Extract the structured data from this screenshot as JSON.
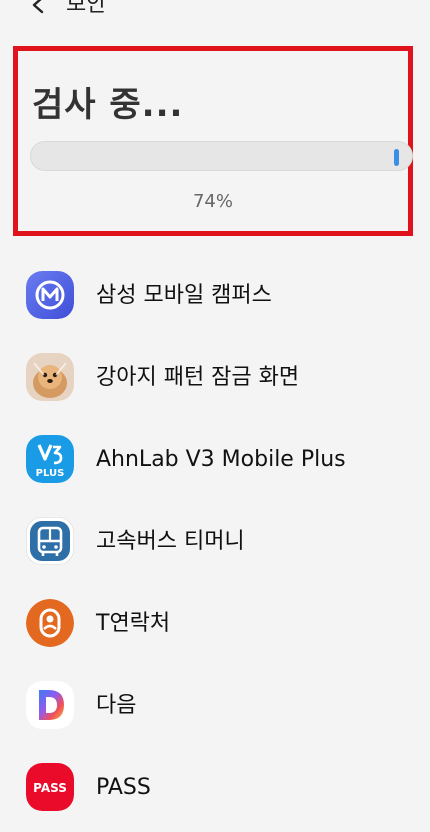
{
  "header": {
    "back_icon": "chevron-left-icon",
    "title": "보안"
  },
  "scan": {
    "title": "검사 중...",
    "progress_percent": 74,
    "progress_label": "74%",
    "highlight_color": "#e0121b",
    "marker_color": "#3a8ee6"
  },
  "apps": [
    {
      "label": "삼성 모바일 캠퍼스",
      "icon": "samsung-campus-icon"
    },
    {
      "label": "강아지 패턴 잠금 화면",
      "icon": "puppy-lockscreen-icon"
    },
    {
      "label": "AhnLab V3 Mobile Plus",
      "icon": "v3-icon",
      "icon_text": "PLUS"
    },
    {
      "label": "고속버스 티머니",
      "icon": "bus-icon"
    },
    {
      "label": "T연락처",
      "icon": "t-contacts-icon"
    },
    {
      "label": "다음",
      "icon": "daum-icon"
    },
    {
      "label": "PASS",
      "icon": "pass-icon",
      "icon_text": "PASS"
    }
  ]
}
